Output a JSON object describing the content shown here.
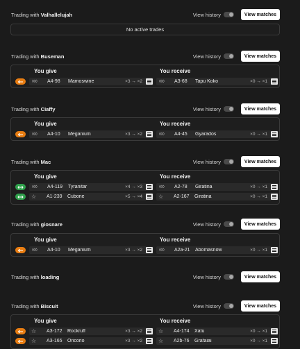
{
  "common": {
    "view_history": "View history",
    "view_matches": "View matches",
    "you_give": "You give",
    "you_receive": "You receive",
    "trading_with": "Trading with"
  },
  "trades": [
    {
      "user": "Valhallelujah",
      "empty_text": "No active trades"
    },
    {
      "user": "Buseman",
      "give": [
        {
          "rarity": "◊◊◊",
          "code": "A4-98",
          "name": "Mamoswine",
          "qty": "×3 → ×2"
        }
      ],
      "receive": [
        {
          "rarity": "◊◊◊",
          "code": "A3-68",
          "name": "Tapu Koko",
          "qty": "×0 → ×1"
        }
      ]
    },
    {
      "user": "Ciaffy",
      "give": [
        {
          "rarity": "◊◊◊",
          "code": "A4-10",
          "name": "Meganium",
          "qty": "×3 → ×2"
        }
      ],
      "receive": [
        {
          "rarity": "◊◊◊",
          "code": "A4-45",
          "name": "Gyarados",
          "qty": "×0 → ×1"
        }
      ]
    },
    {
      "user": "Mac",
      "give": [
        {
          "rarity": "◊◊◊",
          "code": "A4-119",
          "name": "Tyranitar",
          "qty": "×4 → ×3"
        },
        {
          "rarity": "☆",
          "code": "A1-239",
          "name": "Cubone",
          "qty": "×5 → ×4"
        }
      ],
      "receive": [
        {
          "rarity": "◊◊◊",
          "code": "A2-78",
          "name": "Giratina",
          "qty": "×0 → ×1"
        },
        {
          "rarity": "☆",
          "code": "A2-167",
          "name": "Giratina",
          "qty": "×0 → ×1"
        }
      ]
    },
    {
      "user": "giosnare",
      "give": [
        {
          "rarity": "◊◊◊",
          "code": "A4-10",
          "name": "Meganium",
          "qty": "×3 → ×2"
        }
      ],
      "receive": [
        {
          "rarity": "◊◊◊",
          "code": "A2a-21",
          "name": "Abomasnow",
          "qty": "×0 → ×1"
        }
      ]
    },
    {
      "user": "loading"
    },
    {
      "user": "Biscuit",
      "give": [
        {
          "rarity": "☆",
          "code": "A3-172",
          "name": "Rockruff",
          "qty": "×3 → ×2"
        },
        {
          "rarity": "☆",
          "code": "A3-165",
          "name": "Oricorio",
          "qty": "×3 → ×2"
        }
      ],
      "receive": [
        {
          "rarity": "☆",
          "code": "A4-174",
          "name": "Xatu",
          "qty": "×0 → ×1"
        },
        {
          "rarity": "☆",
          "code": "A2b-76",
          "name": "Grafaiai",
          "qty": "×0 → ×1"
        }
      ]
    }
  ],
  "colors": {
    "orange": "#e87d12",
    "green": "#2fa04b",
    "button_bg": "#ffffff",
    "background": "#1b1b1b"
  },
  "icons": {
    "arrow_left": "arrow-left-icon",
    "swap": "swap-arrows-icon",
    "list": "list-icon",
    "rarity_diamond": "diamond-rarity-icon",
    "rarity_star": "star-rarity-icon"
  }
}
